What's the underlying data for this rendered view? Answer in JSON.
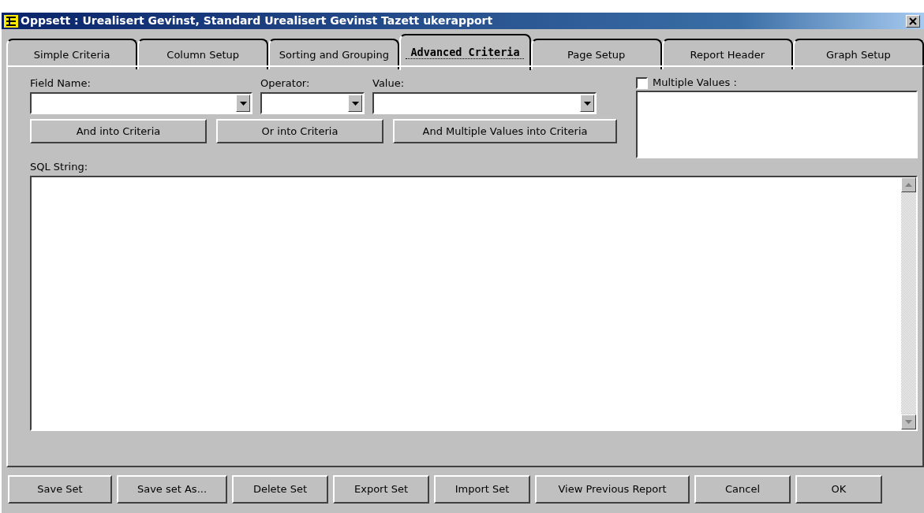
{
  "window": {
    "title": "Oppsett : Urealisert Gevinst, Standard Urealisert Gevinst Tazett ukerapport"
  },
  "tabs": [
    {
      "label": "Simple Criteria",
      "selected": false
    },
    {
      "label": "Column Setup",
      "selected": false
    },
    {
      "label": "Sorting and Grouping",
      "selected": false
    },
    {
      "label": "Advanced Criteria",
      "selected": true
    },
    {
      "label": "Page Setup",
      "selected": false
    },
    {
      "label": "Report Header",
      "selected": false
    },
    {
      "label": "Graph Setup",
      "selected": false
    }
  ],
  "fields": [
    {
      "label": "Field Name:"
    },
    {
      "label": "Operator:"
    },
    {
      "label": "Value:"
    }
  ],
  "criteria_buttons": [
    "And into Criteria",
    "Or into Criteria",
    "And Multiple Values into Criteria"
  ],
  "multiple_values": {
    "label": "Multiple Values :",
    "checked": false
  },
  "sql_string": {
    "label": "SQL String:"
  },
  "buttons": [
    "Save Set",
    "Save set As...",
    "Delete Set",
    "Export Set",
    "Import Set",
    "View Previous Report",
    "Cancel",
    "OK"
  ]
}
